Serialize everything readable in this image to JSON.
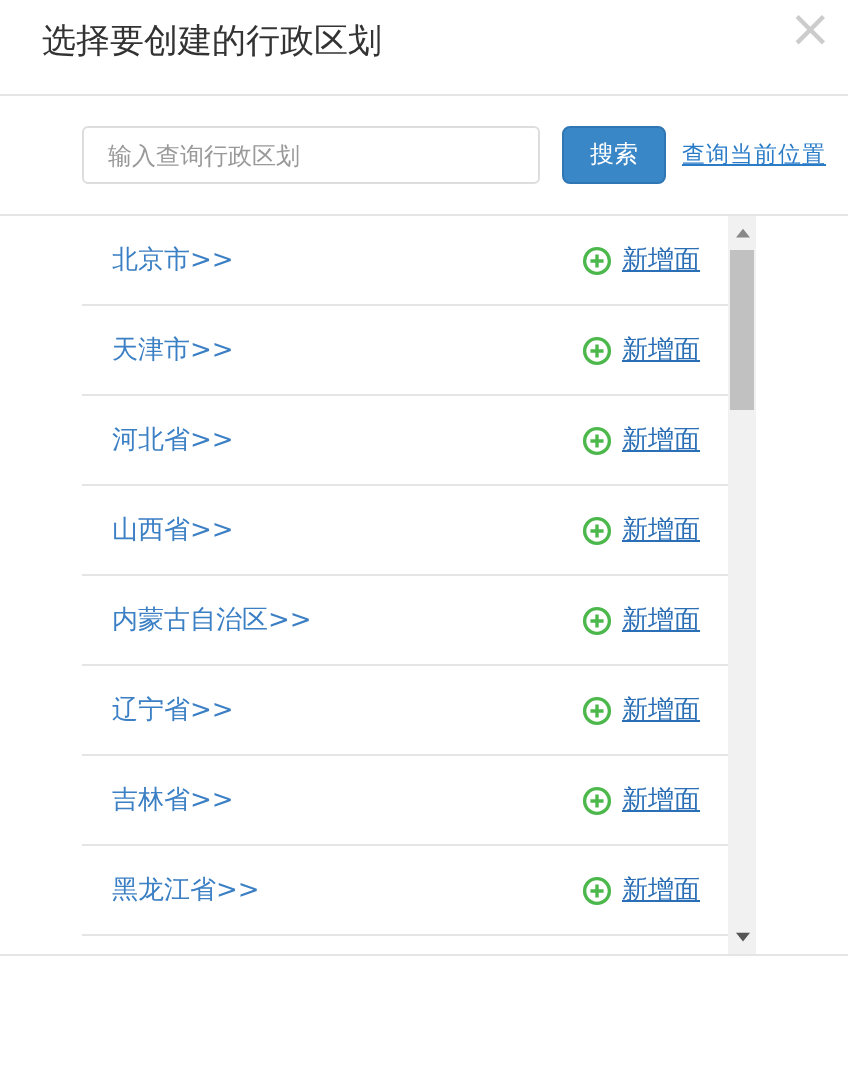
{
  "window": {
    "title": "选择要创建的行政区划",
    "close": "×"
  },
  "search": {
    "placeholder": "输入查询行政区划",
    "button": "搜索",
    "link": "查询当前位置"
  },
  "regions": [
    {
      "name": "北京市>>",
      "action": "新增面"
    },
    {
      "name": "天津市>>",
      "action": "新增面"
    },
    {
      "name": "河北省>>",
      "action": "新增面"
    },
    {
      "name": "山西省>>",
      "action": "新增面"
    },
    {
      "name": "内蒙古自治区>>",
      "action": "新增面"
    },
    {
      "name": "辽宁省>>",
      "action": "新增面"
    },
    {
      "name": "吉林省>>",
      "action": "新增面"
    },
    {
      "name": "黑龙江省>>",
      "action": "新增面"
    }
  ]
}
